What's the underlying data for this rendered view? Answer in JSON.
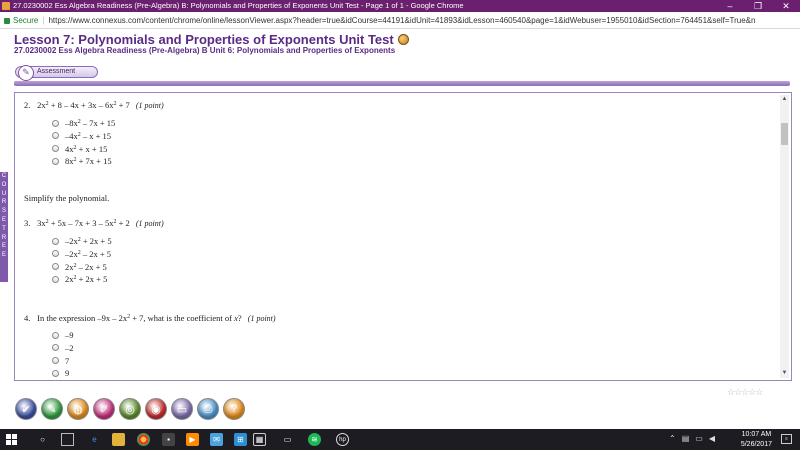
{
  "window": {
    "title": "27.0230002 Ess Algebra Readiness (Pre-Algebra) B: Polynomials and Properties of Exponents Unit Test - Page 1 of 1 - Google Chrome",
    "controls": [
      "–",
      "❐",
      "✕"
    ]
  },
  "address_bar": {
    "secure_label": "Secure",
    "url": "https://www.connexus.com/content/chrome/online/lessonViewer.aspx?header=true&idCourse=44191&idUnit=41893&idLesson=460540&page=1&idWebuser=1955010&idSection=764451&self=True&n"
  },
  "lesson": {
    "title": "Lesson 7: Polynomials and Properties of Exponents Unit Test",
    "subtitle": "27.0230002 Ess Algebra Readiness (Pre-Algebra) B  Unit 6: Polynomials and Properties of Exponents"
  },
  "tab": {
    "label": "Assessment"
  },
  "sidebar": {
    "course_tree_label": [
      "C",
      "O",
      "U",
      "R",
      "S",
      "E",
      "",
      "T",
      "R",
      "E",
      "E"
    ]
  },
  "questions": [
    {
      "number": "2.",
      "prompt_html": "2x<sup>2</sup> + 8 – 4x + 3x – 6x<sup>2</sup> + 7",
      "points": "(1 point)",
      "options_html": [
        "–8x<sup>2</sup> – 7x + 15",
        "–4x<sup>2</sup> – x + 15",
        "4x<sup>2</sup> + x + 15",
        "8x<sup>2</sup> + 7x + 15"
      ]
    },
    {
      "number": "3.",
      "prompt_html": "3x<sup>2</sup> + 5x – 7x + 3 – 5x<sup>2</sup> + 2",
      "points": "(1 point)",
      "options_html": [
        "–2x<sup>2</sup> + 2x + 5",
        "–2x<sup>2</sup> – 2x + 5",
        "2x<sup>2</sup> – 2x + 5",
        "2x<sup>2</sup> + 2x + 5"
      ]
    },
    {
      "number": "4.",
      "prompt_html": "In the expression –9x – 2x<sup>2</sup> + 7, what is the coefficient of <i>x</i>?",
      "points": "(1 point)",
      "options_html": [
        "–9",
        "–2",
        "7",
        "9"
      ]
    }
  ],
  "instruction": "Simplify the polynomial.",
  "rating": "☆☆☆☆☆",
  "tools": [
    {
      "name": "check-tool",
      "glyph": "✔",
      "color": "#3a4fa0"
    },
    {
      "name": "highlighter-tool",
      "glyph": "✎",
      "color": "#2e9a3c"
    },
    {
      "name": "globe-tool",
      "glyph": "◍",
      "color": "#e08a1c"
    },
    {
      "name": "pen-tool",
      "glyph": "✐",
      "color": "#c2307a"
    },
    {
      "name": "target-tool",
      "glyph": "◎",
      "color": "#5a8a2a"
    },
    {
      "name": "bullseye-tool",
      "glyph": "◉",
      "color": "#c22a2a"
    },
    {
      "name": "window-tool",
      "glyph": "▭",
      "color": "#7c6aa8"
    },
    {
      "name": "print-tool",
      "glyph": "⎙",
      "color": "#4a90c8"
    },
    {
      "name": "help-tool",
      "glyph": "?",
      "color": "#e28a1a"
    }
  ],
  "taskbar": {
    "time": "10:07 AM",
    "date": "5/26/2017"
  }
}
